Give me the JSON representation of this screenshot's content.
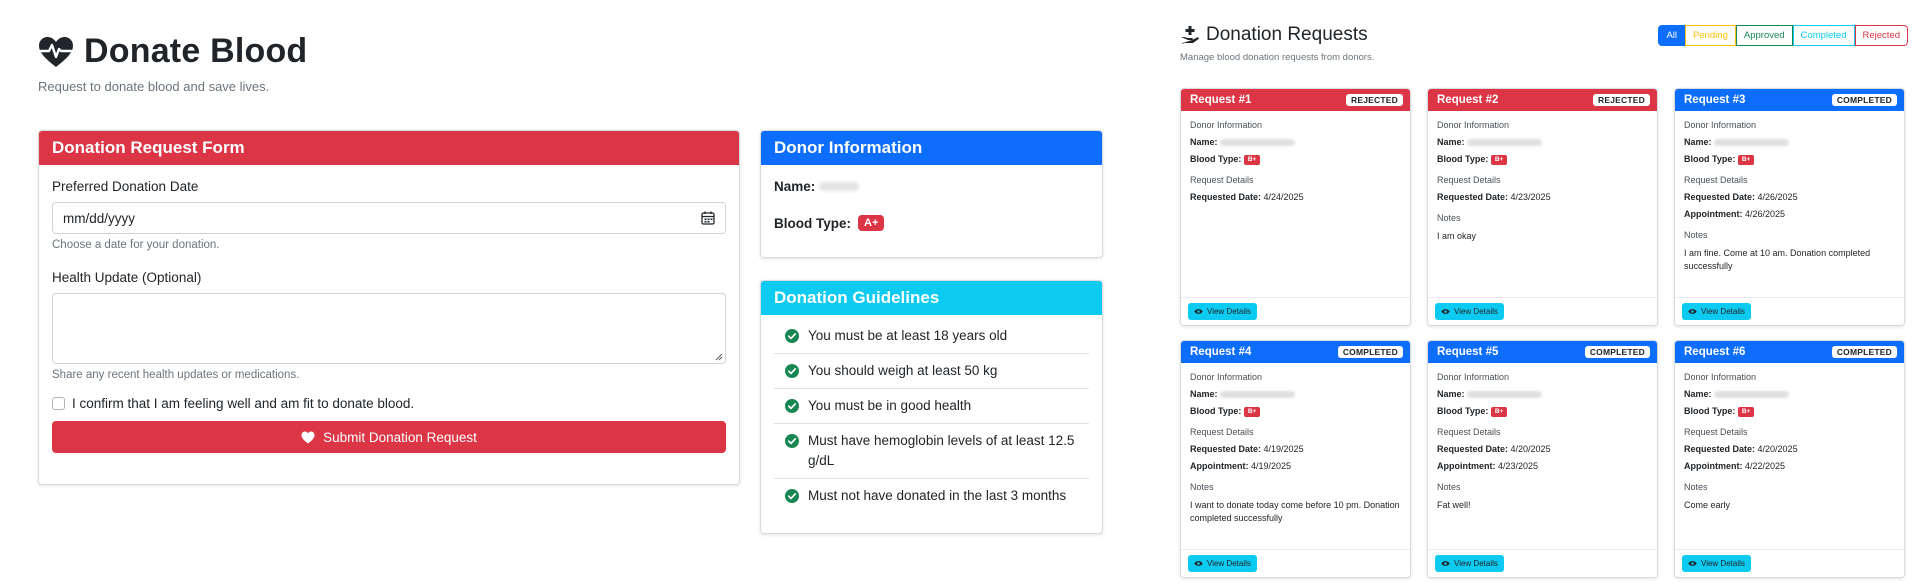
{
  "donate": {
    "title": "Donate Blood",
    "subtitle": "Request to donate blood and save lives.",
    "form": {
      "header": "Donation Request Form",
      "date_label": "Preferred Donation Date",
      "date_placeholder": "mm/dd/yyyy",
      "date_help": "Choose a date for your donation.",
      "health_label": "Health Update (Optional)",
      "health_help": "Share any recent health updates or medications.",
      "confirm_label": "I confirm that I am feeling well and am fit to donate blood.",
      "submit_label": "Submit Donation Request"
    },
    "donor": {
      "header": "Donor Information",
      "name_label": "Name:",
      "blood_type_label": "Blood Type:",
      "blood_type": "A+"
    },
    "guidelines": {
      "header": "Donation Guidelines",
      "items": [
        "You must be at least 18 years old",
        "You should weigh at least 50 kg",
        "You must be in good health",
        "Must have hemoglobin levels of at least 12.5 g/dL",
        "Must not have donated in the last 3 months"
      ]
    }
  },
  "requests": {
    "title": "Donation Requests",
    "subtitle": "Manage blood donation requests from donors.",
    "filters": [
      "All",
      "Pending",
      "Approved",
      "Completed",
      "Rejected"
    ],
    "labels": {
      "donor_info": "Donor Information",
      "name": "Name:",
      "blood_type": "Blood Type:",
      "request_details": "Request Details",
      "requested_date": "Requested Date:",
      "appointment": "Appointment:",
      "notes": "Notes",
      "view": "View Details"
    },
    "colors": {
      "rejected": "#dc3545",
      "completed": "#0d6efd",
      "info": "#0dcaf0"
    },
    "cards": [
      {
        "title": "Request #1",
        "status": "REJECTED",
        "blood": "B+",
        "requested": "4/24/2025"
      },
      {
        "title": "Request #2",
        "status": "REJECTED",
        "blood": "B+",
        "requested": "4/23/2025",
        "notes": "I am okay"
      },
      {
        "title": "Request #3",
        "status": "COMPLETED",
        "blood": "B+",
        "requested": "4/26/2025",
        "appointment": "4/26/2025",
        "notes": "I am fine. Come at 10 am. Donation completed successfully"
      },
      {
        "title": "Request #4",
        "status": "COMPLETED",
        "blood": "B+",
        "requested": "4/19/2025",
        "appointment": "4/19/2025",
        "notes": "I want to donate today come before 10 pm. Donation completed successfully"
      },
      {
        "title": "Request #5",
        "status": "COMPLETED",
        "blood": "B+",
        "requested": "4/20/2025",
        "appointment": "4/23/2025",
        "notes": "Fat well!"
      },
      {
        "title": "Request #6",
        "status": "COMPLETED",
        "blood": "B+",
        "requested": "4/20/2025",
        "appointment": "4/22/2025",
        "notes": "Come early"
      }
    ]
  }
}
